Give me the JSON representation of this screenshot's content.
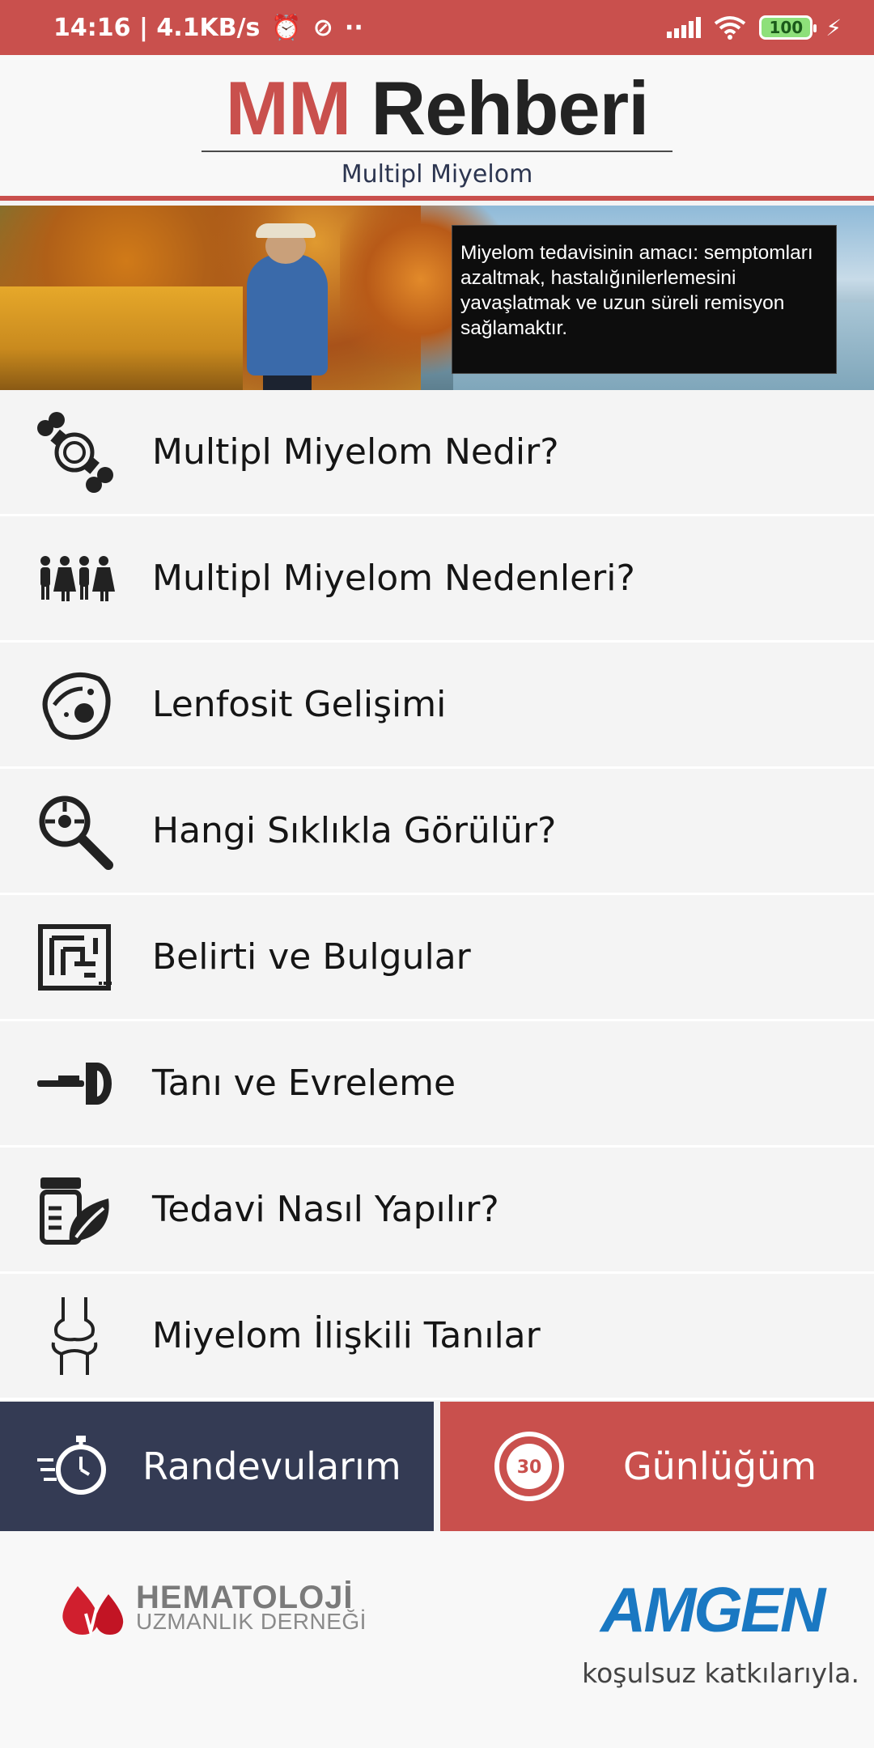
{
  "status_bar": {
    "time_speed": "14:16 | 4.1KB/s",
    "battery": "100",
    "icons": [
      "alarm-icon",
      "sync-icon",
      "dots-icon",
      "signal-icon",
      "wifi-icon",
      "battery-icon",
      "charging-icon"
    ]
  },
  "header": {
    "brand_mm": "MM",
    "brand_rehberi": "Rehberi",
    "subtitle": "Multipl Miyelom"
  },
  "hero": {
    "caption": "Miyelom tedavisinin amacı: semptomları azaltmak, hastalığınilerlemesini yavaşlatmak ve uzun süreli remisyon sağlamaktır."
  },
  "menu": [
    {
      "label": "Multipl Miyelom Nedir?",
      "icon": "bone-icon"
    },
    {
      "label": "Multipl Miyelom Nedenleri?",
      "icon": "people-icon"
    },
    {
      "label": "Lenfosit Gelişimi",
      "icon": "cell-icon"
    },
    {
      "label": "Hangi Sıklıkla Görülür?",
      "icon": "magnifier-icon"
    },
    {
      "label": "Belirti ve Bulgular",
      "icon": "maze-icon"
    },
    {
      "label": "Tanı ve Evreleme",
      "icon": "scanner-icon"
    },
    {
      "label": "Tedavi Nasıl Yapılır?",
      "icon": "medicine-icon"
    },
    {
      "label": "Miyelom İlişkili Tanılar",
      "icon": "joint-icon"
    }
  ],
  "buttons": {
    "appointments": "Randevularım",
    "diary": "Günlüğüm",
    "diary_icon_number": "30"
  },
  "footer": {
    "hem_line1": "HEMATOLOJİ",
    "hem_line2": "UZMANLIK DERNEĞİ",
    "amgen": "AMGEN",
    "note": "koşulsuz katkılarıyla."
  },
  "colors": {
    "accent_red": "#c9504d",
    "navy": "#343b54",
    "amgen_blue": "#1a78c2"
  }
}
